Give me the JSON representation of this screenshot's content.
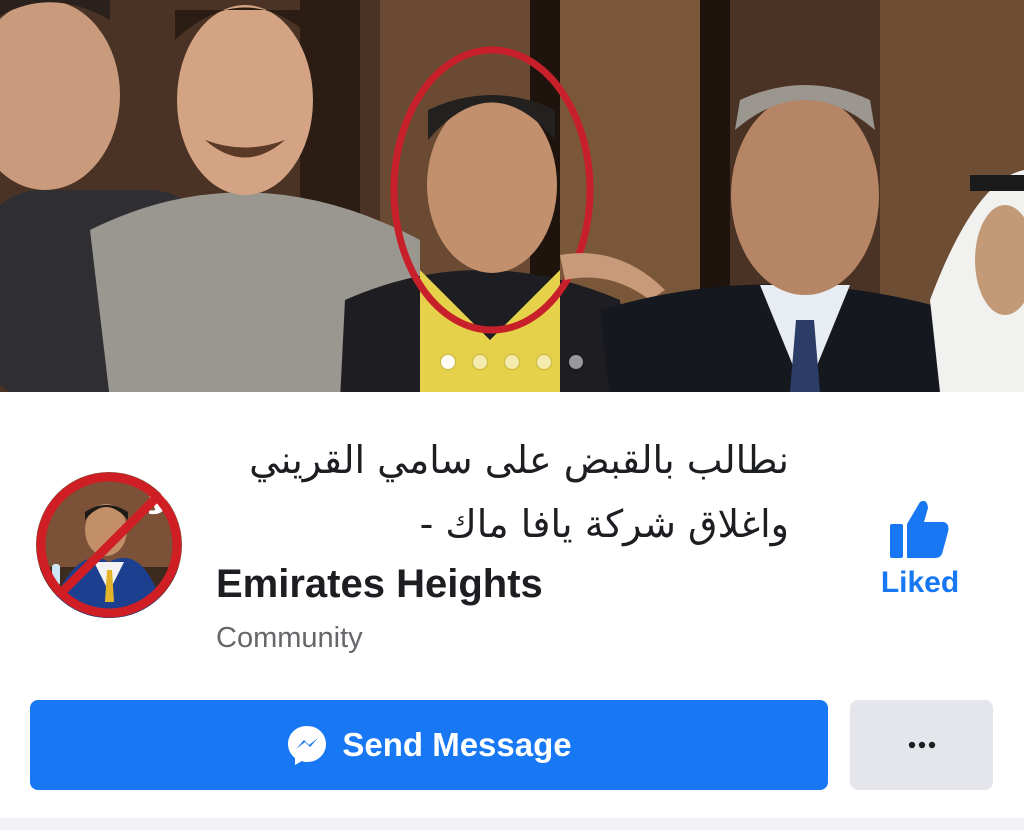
{
  "cover": {
    "photo_icon": "group-photo",
    "carousel": {
      "count": 5,
      "active_index": 0
    }
  },
  "page": {
    "title_ar_line1": "نطالب بالقبض على سامي القريني",
    "title_ar_line2": "واغلاق شركة يافا ماك -",
    "title_en": "Emirates Heights",
    "category": "Community",
    "avatar_badge_text": "لا"
  },
  "actions": {
    "liked_label": "Liked",
    "liked_icon": "thumbs-up-icon",
    "send_message_label": "Send Message",
    "send_message_icon": "messenger-icon",
    "more_icon": "ellipsis-icon"
  },
  "colors": {
    "accent": "#1877f2",
    "secondary_button": "#e4e6eb",
    "text_primary": "#1c1e21",
    "text_secondary": "#65676b",
    "highlight_ring": "#c8202a"
  }
}
